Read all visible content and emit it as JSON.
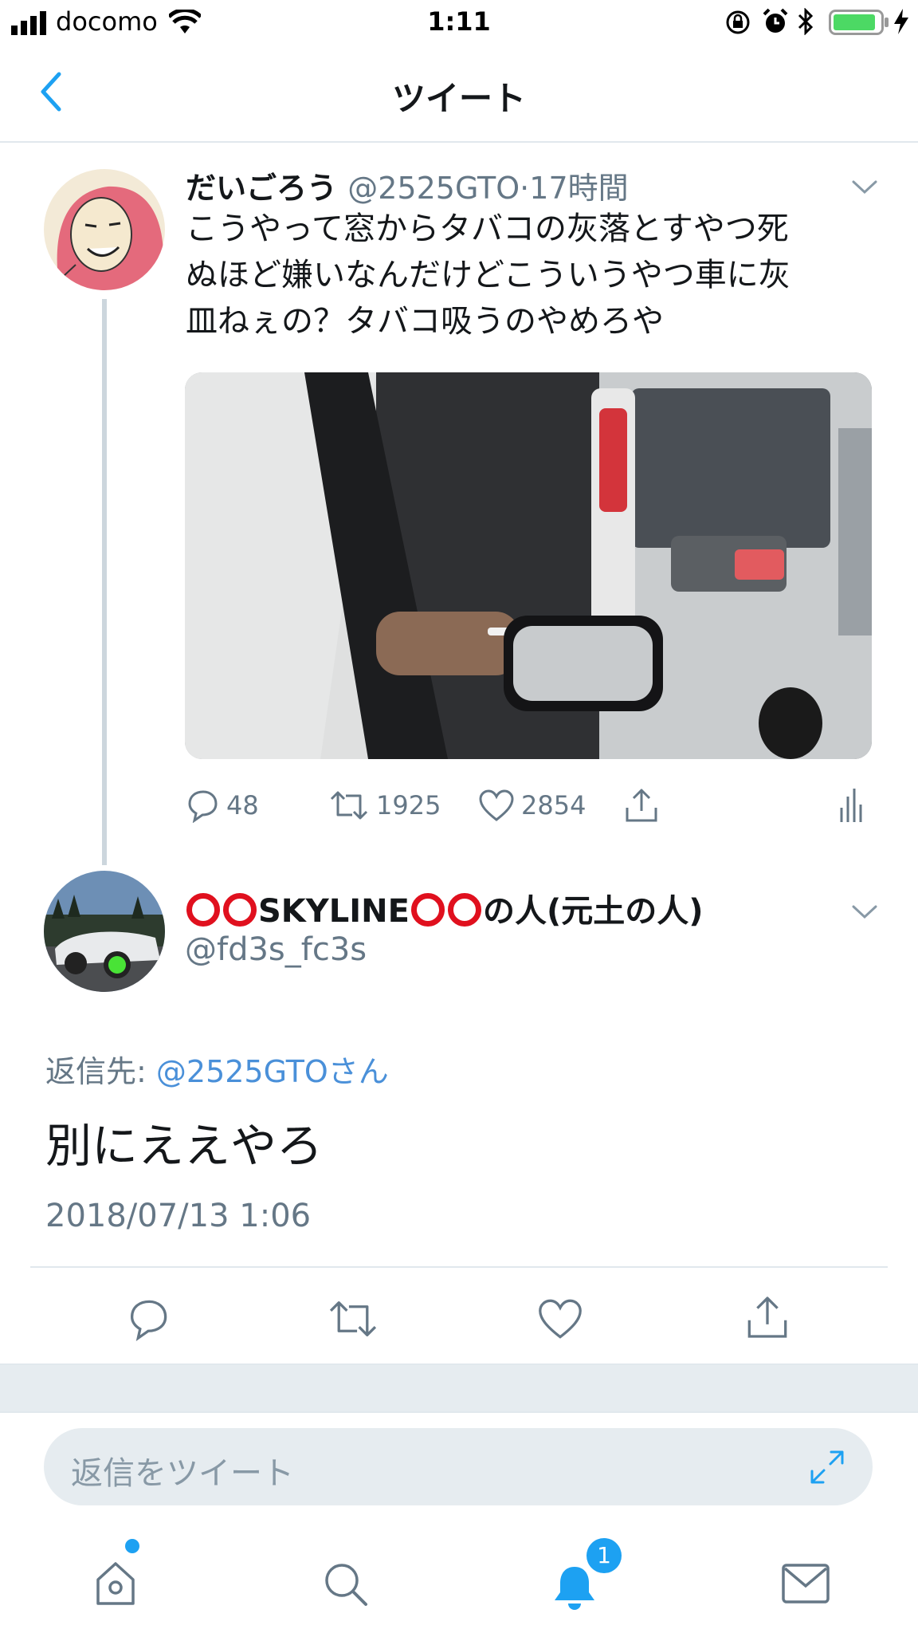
{
  "status_bar": {
    "carrier": "docomo",
    "time": "1:11"
  },
  "nav": {
    "title": "ツイート"
  },
  "tweet": {
    "display_name": "だいごろう",
    "handle": "@2525GTO",
    "separator": "·",
    "relative_time": "17時間",
    "text_lines": [
      "こうやって窓からタバコの灰落とすやつ死",
      "ぬほど嫌いなんだけどこういうやつ車に灰",
      "皿ねぇの？タバコ吸うのやめろや"
    ],
    "actions": {
      "replies": "48",
      "retweets": "1925",
      "likes": "2854"
    }
  },
  "reply": {
    "display_name_parts": [
      "SKYLINE",
      "の人(元土の人)"
    ],
    "handle": "@fd3s_fc3s",
    "replying_prefix": "返信先: ",
    "replying_to": "@2525GTOさん",
    "text": "別にええやろ",
    "timestamp": "2018/07/13 1:06"
  },
  "composer": {
    "placeholder": "返信をツイート"
  },
  "tabbar": {
    "notification_count": "1"
  },
  "colors": {
    "accent": "#1da1f2",
    "link": "#4a90d9",
    "muted": "#657786",
    "ring_red": "#e0101e"
  }
}
